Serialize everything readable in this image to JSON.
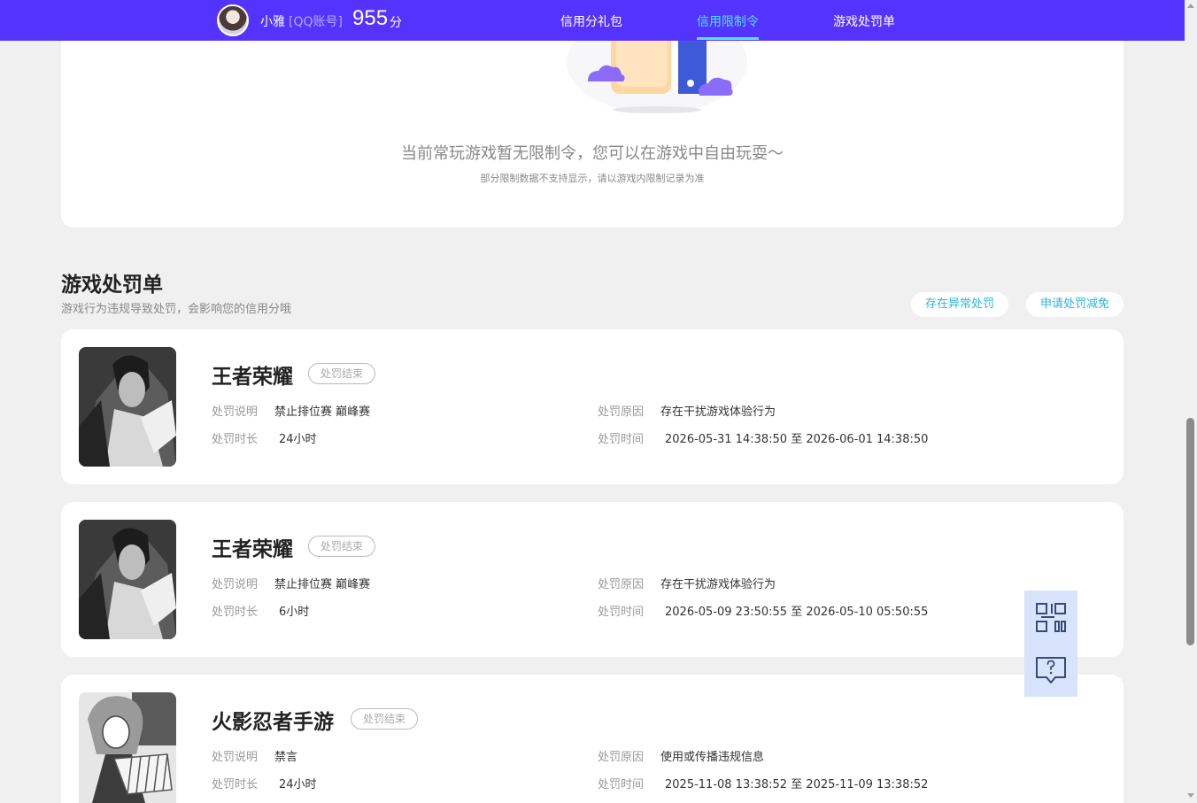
{
  "header": {
    "username": "小雅",
    "account_type": "[QQ账号]",
    "score": "955",
    "score_unit": "分",
    "nav": [
      {
        "label": "信用分礼包"
      },
      {
        "label": "信用限制令"
      },
      {
        "label": "游戏处罚单"
      }
    ],
    "active_nav": "信用限制令",
    "accent_color": "#5533ff",
    "active_color": "#4ee3ff"
  },
  "empty_state": {
    "title": "当前常玩游戏暂无限制令，您可以在游戏中自由玩耍～",
    "subtitle": "部分限制数据不支持显示，请以游戏内限制记录为准"
  },
  "penalty_section": {
    "title": "游戏处罚单",
    "subtitle": "游戏行为违规导致处罚，会影响您的信用分哦",
    "btn_abnormal": "存在异常处罚",
    "btn_appeal": "申请处罚减免"
  },
  "labels": {
    "desc": "处罚说明",
    "duration": "处罚时长",
    "reason": "处罚原因",
    "time": "处罚时间"
  },
  "penalties": [
    {
      "game": "王者荣耀",
      "status": "处罚结束",
      "desc": "禁止排位赛 巅峰赛",
      "duration": "24小时",
      "reason": "存在干扰游戏体验行为",
      "time": "2026-05-31 14:38:50 至 2026-06-01 14:38:50"
    },
    {
      "game": "王者荣耀",
      "status": "处罚结束",
      "desc": "禁止排位赛 巅峰赛",
      "duration": "6小时",
      "reason": "存在干扰游戏体验行为",
      "time": "2026-05-09 23:50:55 至 2026-05-10 05:50:55"
    },
    {
      "game": "火影忍者手游",
      "status": "处罚结束",
      "desc": "禁言",
      "duration": "24小时",
      "reason": "使用或传播违规信息",
      "time": "2025-11-08 13:38:52 至 2025-11-09 13:38:52"
    }
  ],
  "floating_tools": [
    {
      "icon": "qr-code-icon"
    },
    {
      "icon": "help-chat-icon"
    }
  ]
}
